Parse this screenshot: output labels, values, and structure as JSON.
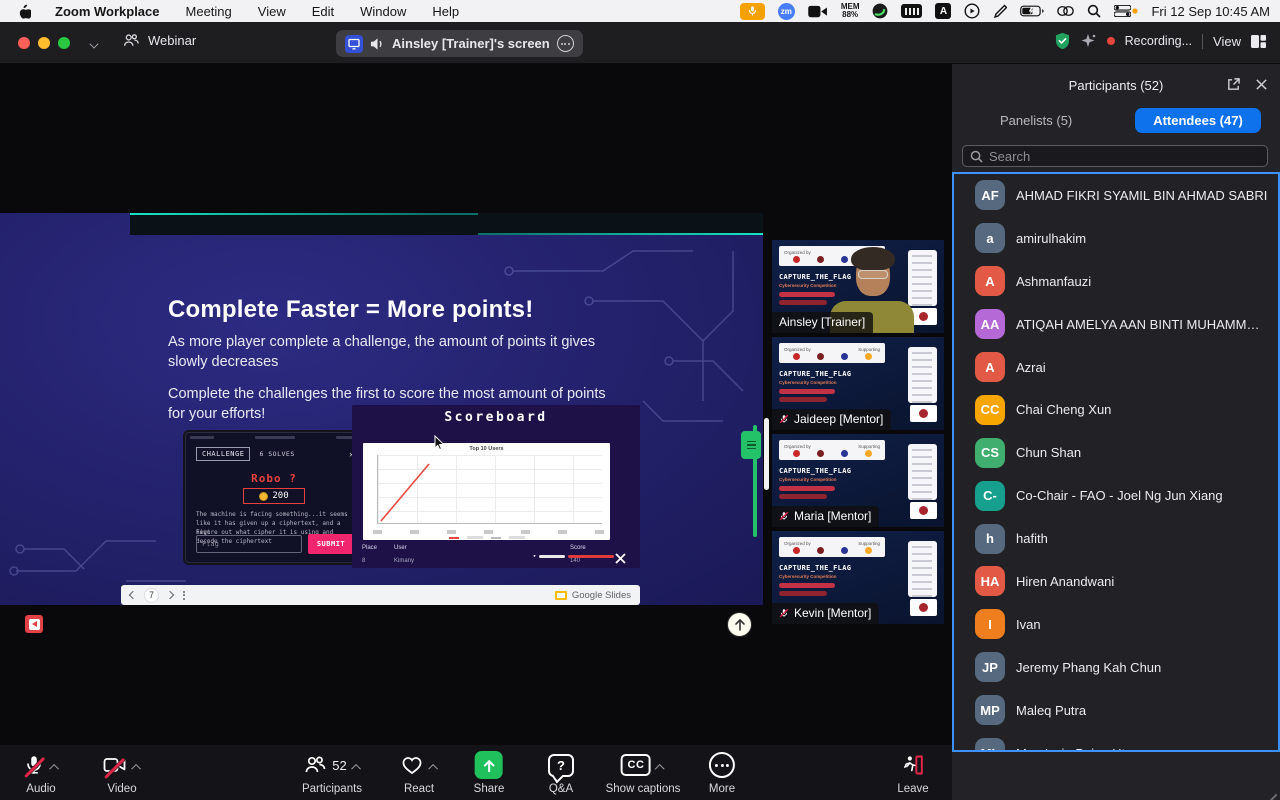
{
  "menubar": {
    "items": [
      "Zoom Workplace",
      "Meeting",
      "View",
      "Edit",
      "Window",
      "Help"
    ],
    "status": {
      "zm_badge": "zm",
      "mem_line1": "MEM",
      "mem_line2": "88%",
      "a_badge": "A",
      "clock": "Fri 12 Sep 10:45 AM"
    }
  },
  "titlebar": {
    "window_label": "Webinar",
    "shared_screen_label": "Ainsley [Trainer]'s screen",
    "recording_label": "Recording...",
    "view_label": "View"
  },
  "stage": {
    "slide": {
      "heading": "Complete Faster = More points!",
      "body1": "As more player complete a challenge, the amount of points it gives slowly decreases",
      "body2": "Complete the challenges the first to score the most amount of points for your efforts!",
      "scoreboard_title": "Scoreboard",
      "chart_title": "Top 10 Users",
      "table": {
        "headers": [
          "Place",
          "User",
          "Score"
        ],
        "row": [
          "8",
          "Kimany",
          "140"
        ]
      },
      "challenge": {
        "tab": "CHALLENGE",
        "solves": "6 SOLVES",
        "title": "Robo ?",
        "points": "200",
        "desc1": "The machine is facing something...it seems like it has given up a ciphertext, and a key!",
        "desc2": "Figure out what cipher it is using and decode the ciphertext",
        "flag_placeholder": "Flag",
        "submit_label": "SUBMIT"
      },
      "page_number": "7",
      "gslides_label": "Google Slides"
    },
    "thumbnails": {
      "poster": {
        "organized_by": "Organized by",
        "supporting": "Supporting",
        "title": "CAPTURE_THE_FLAG",
        "subtitle": "Cybersecurity Competition"
      },
      "items": [
        {
          "name": "Ainsley [Trainer]",
          "muted": false,
          "active": true,
          "has_person": true
        },
        {
          "name": "Jaideep [Mentor]",
          "muted": true
        },
        {
          "name": "Maria [Mentor]",
          "muted": true
        },
        {
          "name": "Kevin [Mentor]",
          "muted": true
        }
      ]
    }
  },
  "panel": {
    "title": "Participants (52)",
    "tab_panelists": "Panelists (5)",
    "tab_attendees": "Attendees (47)",
    "search_placeholder": "Search",
    "attendees": [
      {
        "initials": "AF",
        "name": "AHMAD FIKRI SYAMIL BIN AHMAD SABRI",
        "color": "#56697e"
      },
      {
        "initials": "a",
        "name": "amirulhakim",
        "color": "#56697e"
      },
      {
        "initials": "A",
        "name": "Ashmanfauzi",
        "color": "#e25a45"
      },
      {
        "initials": "AA",
        "name": "ATIQAH AMELYA AAN BINTI MUHAMMAD TAU...",
        "color": "#b469d6"
      },
      {
        "initials": "A",
        "name": "Azrai",
        "color": "#e25a45"
      },
      {
        "initials": "CC",
        "name": "Chai Cheng Xun",
        "color": "#f7a600"
      },
      {
        "initials": "CS",
        "name": "Chun Shan",
        "color": "#3fae6f"
      },
      {
        "initials": "C-",
        "name": "Co-Chair - FAO - Joel Ng Jun Xiang",
        "color": "#16a08d"
      },
      {
        "initials": "h",
        "name": "hafith",
        "color": "#56697e"
      },
      {
        "initials": "HA",
        "name": "Hiren Anandwani",
        "color": "#e25a45"
      },
      {
        "initials": "I",
        "name": "Ivan",
        "color": "#ef7e1f"
      },
      {
        "initials": "JP",
        "name": "Jeremy Phang Kah Chun",
        "color": "#56697e"
      },
      {
        "initials": "MP",
        "name": "Maleq Putra",
        "color": "#56697e"
      },
      {
        "initials": "ML",
        "name": "Moe Lwin Paing Htoo",
        "color": "#56697e"
      }
    ]
  },
  "toolbar": {
    "audio_label": "Audio",
    "video_label": "Video",
    "participants_label": "Participants",
    "participants_count": "52",
    "react_label": "React",
    "share_label": "Share",
    "qa_label": "Q&A",
    "qa_glyph": "?",
    "captions_label": "Show captions",
    "cc_glyph": "CC",
    "more_label": "More",
    "leave_label": "Leave"
  },
  "colors": {
    "accent_blue": "#0e72ed",
    "recording_red": "#e8453c",
    "share_green": "#20c05c",
    "active_green": "#21b551"
  }
}
